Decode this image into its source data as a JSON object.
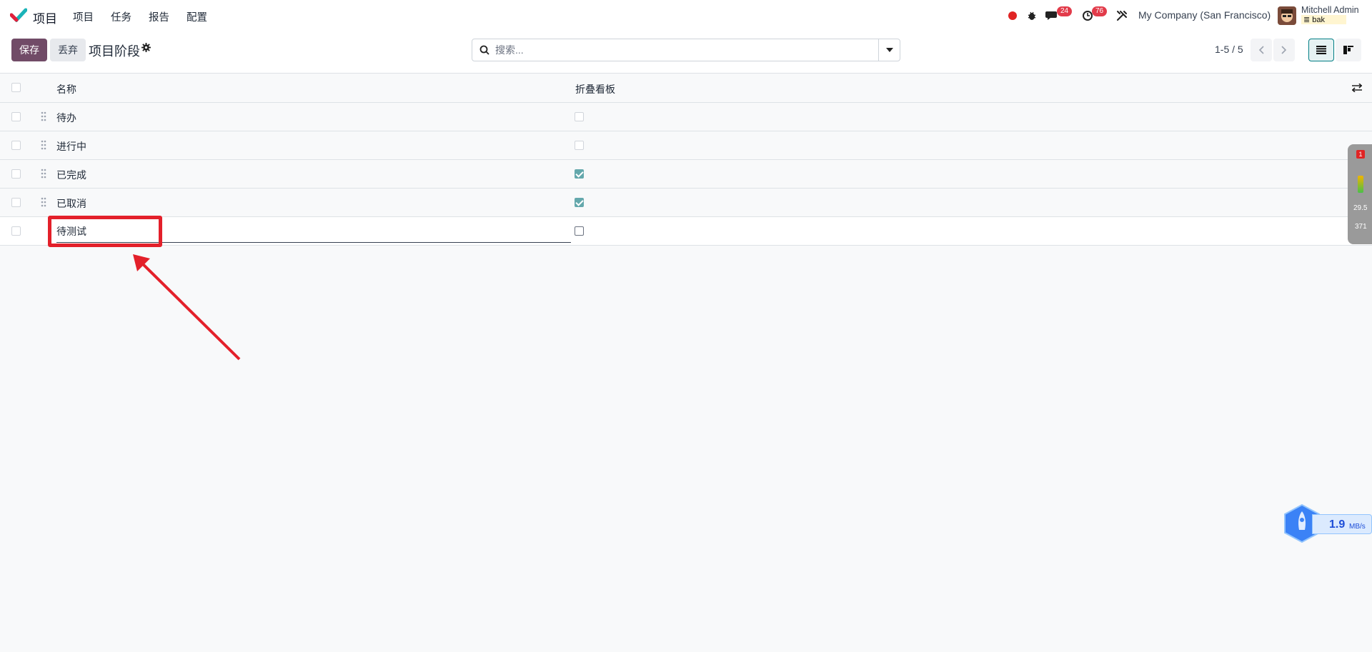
{
  "navbar": {
    "app_name": "项目",
    "menu": [
      "项目",
      "任务",
      "报告",
      "配置"
    ],
    "messages_count": "24",
    "activities_count": "76",
    "company": "My Company (San Francisco)",
    "user_name": "Mitchell Admin",
    "database": "bak"
  },
  "control": {
    "save_label": "保存",
    "discard_label": "丢弃",
    "breadcrumb": "项目阶段",
    "search_placeholder": "搜索...",
    "pager": "1-5 / 5"
  },
  "table": {
    "headers": {
      "name": "名称",
      "fold": "折叠看板"
    },
    "rows": [
      {
        "name": "待办",
        "fold": false
      },
      {
        "name": "进行中",
        "fold": false
      },
      {
        "name": "已完成",
        "fold": true
      },
      {
        "name": "已取消",
        "fold": true
      }
    ],
    "editing_row": {
      "name": "待测试",
      "fold": false
    }
  },
  "widgets": {
    "monitor_alert": "1",
    "monitor_v1": "29.5",
    "monitor_v2": "371",
    "speed_value": "1.9",
    "speed_unit": "MB/s"
  },
  "colors": {
    "primary": "#714b67",
    "accent": "#017e84",
    "annotation": "#e3202a"
  }
}
